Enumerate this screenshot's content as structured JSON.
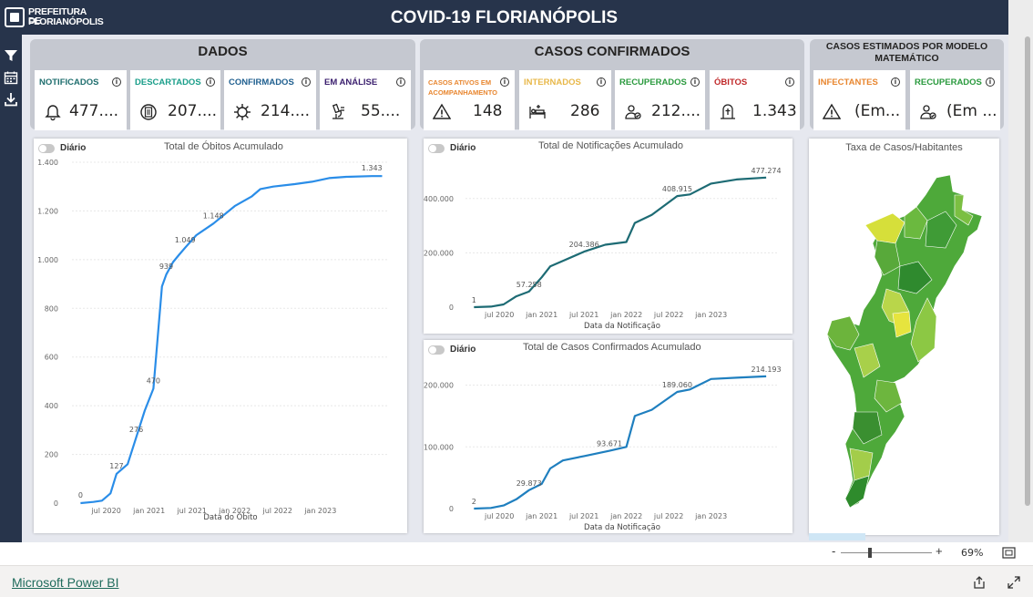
{
  "header": {
    "logo_line1": "PREFEITURA DE",
    "logo_line2": "FLORIANÓPOLIS",
    "title": "COVID-19 FLORIANÓPOLIS"
  },
  "groups": {
    "dados": "DADOS",
    "casos": "CASOS CONFIRMADOS",
    "estimados": "CASOS ESTIMADOS POR MODELO MATEMÁTICO"
  },
  "kpis": [
    {
      "label": "NOTIFICADOS",
      "value": "477....",
      "color": "#1e6e6e",
      "icon": "bell-icon"
    },
    {
      "label": "DESCARTADOS",
      "value": "207....",
      "color": "#1a9e8a",
      "icon": "document-icon"
    },
    {
      "label": "CONFIRMADOS",
      "value": "214....",
      "color": "#1f5f8f",
      "icon": "virus-icon"
    },
    {
      "label": "EM ANÁLISE",
      "value": "55....",
      "color": "#3b1f6e",
      "icon": "microscope-icon"
    },
    {
      "label": "CASOS ATIVOS EM ACOMPANHAMENTO",
      "value": "148",
      "color": "#e8862f",
      "icon": "warning-icon"
    },
    {
      "label": "INTERNADOS",
      "value": "286",
      "color": "#e8b84a",
      "icon": "hospital-bed-icon"
    },
    {
      "label": "RECUPERADOS",
      "value": "212....",
      "color": "#2a9a3e",
      "icon": "recovered-person-icon"
    },
    {
      "label": "ÓBITOS",
      "value": "1.343",
      "color": "#c0292a",
      "icon": "grave-icon"
    },
    {
      "label": "INFECTANTES",
      "value": "(Em...",
      "color": "#e8862f",
      "icon": "warning-icon"
    },
    {
      "label": "RECUPERADOS",
      "value": "(Em ...",
      "color": "#2a9a3e",
      "icon": "recovered-person-icon"
    }
  ],
  "toggle_label": "Diário",
  "map": {
    "title": "Taxa de Casos/Habitantes"
  },
  "status": {
    "zoom": "69%",
    "zoom_minus": "-",
    "zoom_plus": "+"
  },
  "footer": {
    "link": "Microsoft Power BI"
  },
  "colors": {
    "header_bg": "#27344b",
    "canvas_bg": "#e6e8ef",
    "line_obitos": "#2a8de8",
    "line_notif": "#1d6b74",
    "line_conf": "#1f7fbf"
  },
  "chart_data": [
    {
      "type": "line",
      "title": "Total de Óbitos Acumulado",
      "xlabel": "Data do Óbito",
      "ylabel": "",
      "x_ticks": [
        "jul 2020",
        "jan 2021",
        "jul 2021",
        "jan 2022",
        "jul 2022",
        "jan 2023"
      ],
      "y_ticks": [
        "0",
        "200",
        "400",
        "600",
        "800",
        "1.000",
        "1.200",
        "1.400"
      ],
      "ylim": [
        0,
        1400
      ],
      "x": [
        2020.2,
        2020.35,
        2020.45,
        2020.55,
        2020.62,
        2020.75,
        2020.85,
        2020.95,
        2021.05,
        2021.15,
        2021.2,
        2021.28,
        2021.35,
        2021.42,
        2021.55,
        2021.75,
        2022.0,
        2022.2,
        2022.3,
        2022.45,
        2022.7,
        2022.9,
        2023.1,
        2023.3,
        2023.6,
        2023.72
      ],
      "y": [
        0,
        5,
        10,
        40,
        120,
        160,
        270,
        380,
        470,
        890,
        939,
        990,
        1020,
        1049,
        1100,
        1148,
        1220,
        1260,
        1290,
        1300,
        1310,
        1320,
        1335,
        1340,
        1343,
        1343
      ],
      "data_labels": [
        {
          "x": 2020.2,
          "text": "0"
        },
        {
          "x": 2020.62,
          "text": "127"
        },
        {
          "x": 2020.85,
          "text": "276"
        },
        {
          "x": 2021.05,
          "text": "470"
        },
        {
          "x": 2021.2,
          "text": "939"
        },
        {
          "x": 2021.42,
          "text": "1.049"
        },
        {
          "x": 2021.75,
          "text": "1.148"
        },
        {
          "x": 2023.6,
          "text": "1.343"
        }
      ]
    },
    {
      "type": "line",
      "title": "Total de Notificações Acumulado",
      "xlabel": "Data da Notificação",
      "ylabel": "",
      "x_ticks": [
        "jul 2020",
        "jan 2021",
        "jul 2021",
        "jan 2022",
        "jul 2022",
        "jan 2023"
      ],
      "y_ticks": [
        "0",
        "200.000",
        "400.000"
      ],
      "ylim": [
        0,
        500000
      ],
      "x": [
        2020.2,
        2020.4,
        2020.55,
        2020.7,
        2020.85,
        2021.0,
        2021.1,
        2021.25,
        2021.5,
        2021.75,
        2022.0,
        2022.1,
        2022.3,
        2022.6,
        2022.75,
        2023.0,
        2023.3,
        2023.65
      ],
      "y": [
        1,
        2000,
        10000,
        40000,
        57258,
        110000,
        150000,
        170000,
        204386,
        230000,
        240000,
        310000,
        340000,
        408915,
        415000,
        455000,
        470000,
        477274
      ],
      "data_labels": [
        {
          "x": 2020.2,
          "text": "1"
        },
        {
          "x": 2020.85,
          "text": "57.258"
        },
        {
          "x": 2021.5,
          "text": "204.386"
        },
        {
          "x": 2022.6,
          "text": "408.915"
        },
        {
          "x": 2023.65,
          "text": "477.274"
        }
      ]
    },
    {
      "type": "line",
      "title": "Total de Casos Confirmados Acumulado",
      "xlabel": "Data da Notificação",
      "ylabel": "",
      "x_ticks": [
        "jul 2020",
        "jan 2021",
        "jul 2021",
        "jan 2022",
        "jul 2022",
        "jan 2023"
      ],
      "y_ticks": [
        "0",
        "100.000",
        "200.000"
      ],
      "ylim": [
        0,
        220000
      ],
      "x": [
        2020.2,
        2020.4,
        2020.55,
        2020.7,
        2020.85,
        2021.0,
        2021.1,
        2021.25,
        2021.5,
        2021.8,
        2022.0,
        2022.1,
        2022.3,
        2022.6,
        2022.75,
        2023.0,
        2023.3,
        2023.65
      ],
      "y": [
        2,
        1000,
        5000,
        15000,
        29873,
        40000,
        65000,
        78000,
        85000,
        93671,
        100000,
        150000,
        160000,
        189060,
        193000,
        210000,
        212000,
        214193
      ],
      "data_labels": [
        {
          "x": 2020.2,
          "text": "2"
        },
        {
          "x": 2020.85,
          "text": "29.873"
        },
        {
          "x": 2021.8,
          "text": "93.671"
        },
        {
          "x": 2022.6,
          "text": "189.060"
        },
        {
          "x": 2023.65,
          "text": "214.193"
        }
      ]
    }
  ]
}
